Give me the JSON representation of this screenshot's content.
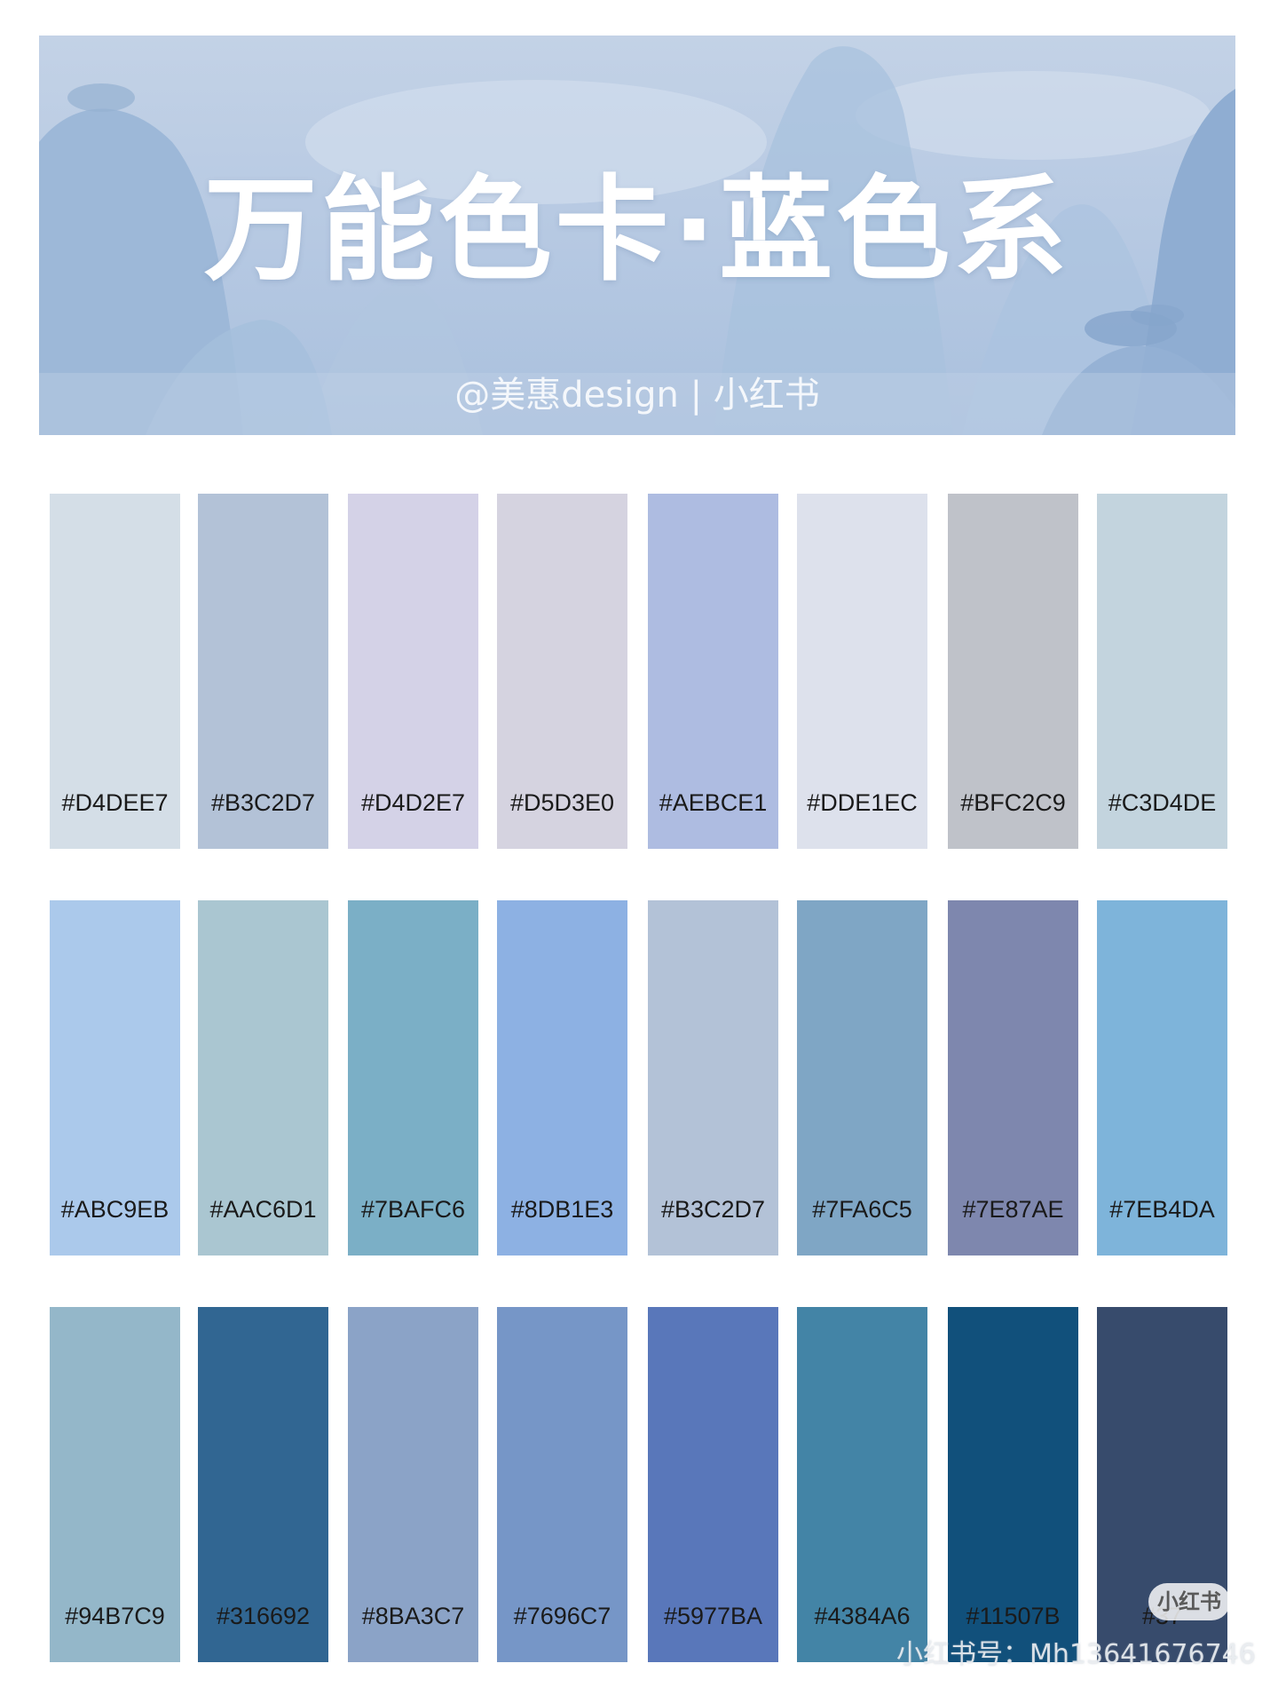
{
  "banner": {
    "title": "万能色卡·蓝色系",
    "subtitle": "@美惠design | 小红书",
    "colors": {
      "sky": "#c3d2e6",
      "mountain_light": "#b4c8e1",
      "mountain_mid": "#9eb9d9",
      "mountain_dark": "#8eadd2"
    }
  },
  "palette": {
    "rows": [
      [
        {
          "label": "#D4DEE7",
          "color": "#D4DEE7"
        },
        {
          "label": "#B3C2D7",
          "color": "#B3C2D7"
        },
        {
          "label": "#D4D2E7",
          "color": "#D4D2E7"
        },
        {
          "label": "#D5D3E0",
          "color": "#D5D3E0"
        },
        {
          "label": "#AEBCE1",
          "color": "#AEBCE1"
        },
        {
          "label": "#DDE1EC",
          "color": "#DDE1EC"
        },
        {
          "label": "#BFC2C9",
          "color": "#BFC2C9"
        },
        {
          "label": "#C3D4DE",
          "color": "#C3D4DE"
        }
      ],
      [
        {
          "label": "#ABC9EB",
          "color": "#ABC9EB"
        },
        {
          "label": "#AAC6D1",
          "color": "#AAC6D1"
        },
        {
          "label": "#7BAFC6",
          "color": "#7BAFC6"
        },
        {
          "label": "#8DB1E3",
          "color": "#8DB1E3"
        },
        {
          "label": "#B3C2D7",
          "color": "#B3C2D7"
        },
        {
          "label": "#7FA6C5",
          "color": "#7FA6C5"
        },
        {
          "label": "#7E87AE",
          "color": "#7E87AE"
        },
        {
          "label": "#7EB4DA",
          "color": "#7EB4DA"
        }
      ],
      [
        {
          "label": "#94B7C9",
          "color": "#94B7C9"
        },
        {
          "label": "#316692",
          "color": "#316692"
        },
        {
          "label": "#8BA3C7",
          "color": "#8BA3C7"
        },
        {
          "label": "#7696C7",
          "color": "#7696C7"
        },
        {
          "label": "#5977BA",
          "color": "#5977BA"
        },
        {
          "label": "#4384A6",
          "color": "#4384A6"
        },
        {
          "label": "#11507B",
          "color": "#11507B"
        },
        {
          "label": "#37",
          "color": "#374B6C"
        }
      ]
    ]
  },
  "watermark": {
    "badge": "小红书",
    "id_text": "小红书号：Mh13641676746"
  }
}
